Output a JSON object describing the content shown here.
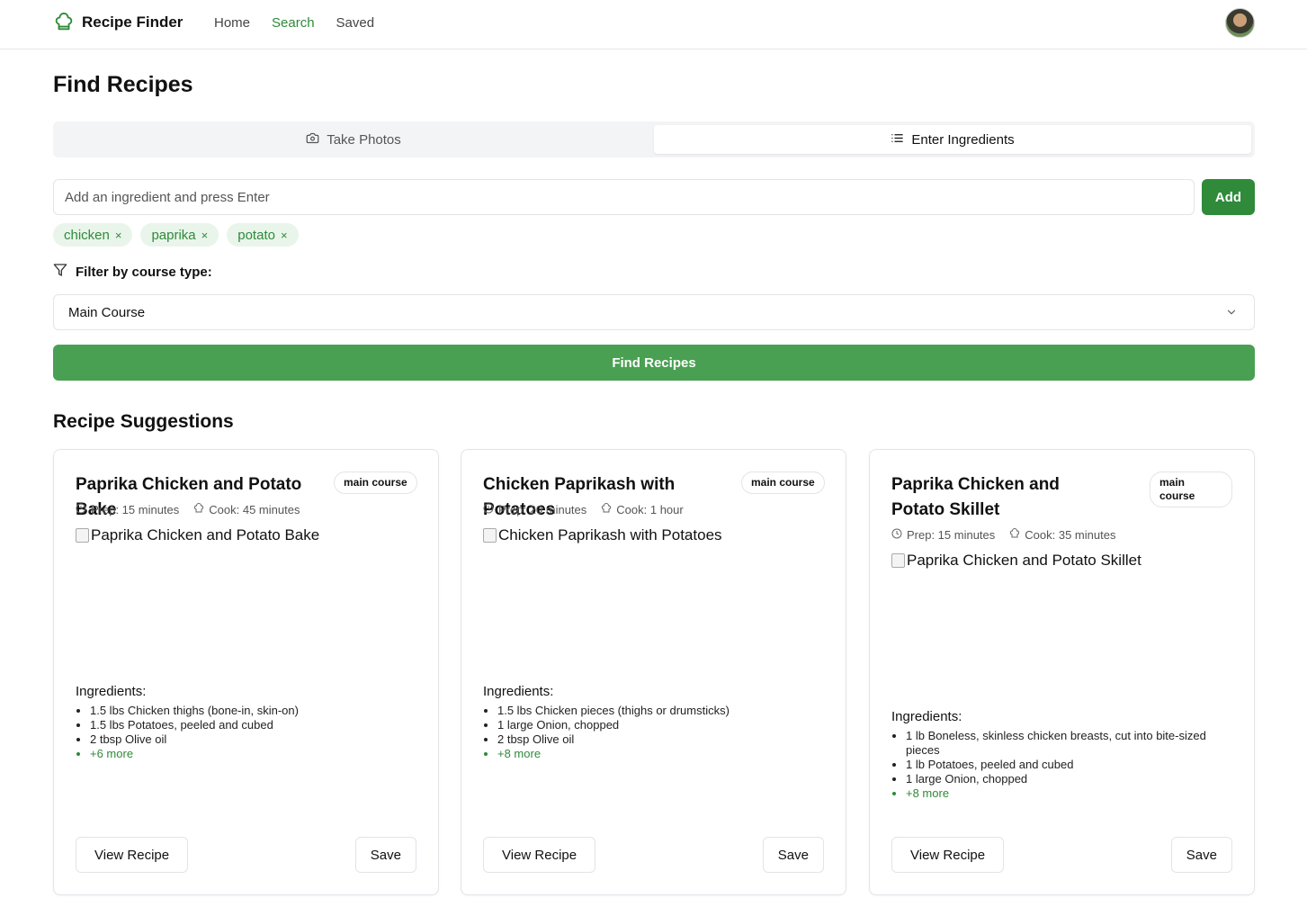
{
  "header": {
    "brand": "Recipe Finder",
    "nav": [
      {
        "label": "Home",
        "active": false
      },
      {
        "label": "Search",
        "active": true
      },
      {
        "label": "Saved",
        "active": false
      }
    ]
  },
  "page_title": "Find Recipes",
  "tabs": [
    {
      "label": "Take Photos",
      "icon": "camera-icon",
      "active": false
    },
    {
      "label": "Enter Ingredients",
      "icon": "list-icon",
      "active": true
    }
  ],
  "ingredient_input": {
    "placeholder": "Add an ingredient and press Enter",
    "value": ""
  },
  "add_button": "Add",
  "chips": [
    "chicken",
    "paprika",
    "potato"
  ],
  "chip_remove": "×",
  "filter": {
    "label": "Filter by course type:",
    "selected": "Main Course"
  },
  "find_button": "Find Recipes",
  "section_title": "Recipe Suggestions",
  "ingredients_heading": "Ingredients:",
  "view_button": "View Recipe",
  "save_button": "Save",
  "recipes": [
    {
      "title": "Paprika Chicken and Potato Bake",
      "badge": "main course",
      "prep": "Prep: 15 minutes",
      "cook": "Cook: 45 minutes",
      "image_alt": "Paprika Chicken and Potato Bake",
      "ingredients": [
        "1.5 lbs Chicken thighs (bone-in, skin-on)",
        "1.5 lbs Potatoes, peeled and cubed",
        "2 tbsp Olive oil"
      ],
      "more": "+6 more"
    },
    {
      "title": "Chicken Paprikash with Potatoes",
      "badge": "main course",
      "prep": "Prep: 20 minutes",
      "cook": "Cook: 1 hour",
      "image_alt": "Chicken Paprikash with Potatoes",
      "ingredients": [
        "1.5 lbs Chicken pieces (thighs or drumsticks)",
        "1 large Onion, chopped",
        "2 tbsp Olive oil"
      ],
      "more": "+8 more"
    },
    {
      "title": "Paprika Chicken and Potato Skillet",
      "badge": "main course",
      "prep": "Prep: 15 minutes",
      "cook": "Cook: 35 minutes",
      "image_alt": "Paprika Chicken and Potato Skillet",
      "ingredients": [
        "1 lb Boneless, skinless chicken breasts, cut into bite-sized pieces",
        "1 lb Potatoes, peeled and cubed",
        "1 large Onion, chopped"
      ],
      "more": "+8 more"
    }
  ],
  "colors": {
    "accent": "#2f8a3a",
    "find_button": "#4aa052",
    "chip_bg": "#e9f5ea"
  }
}
